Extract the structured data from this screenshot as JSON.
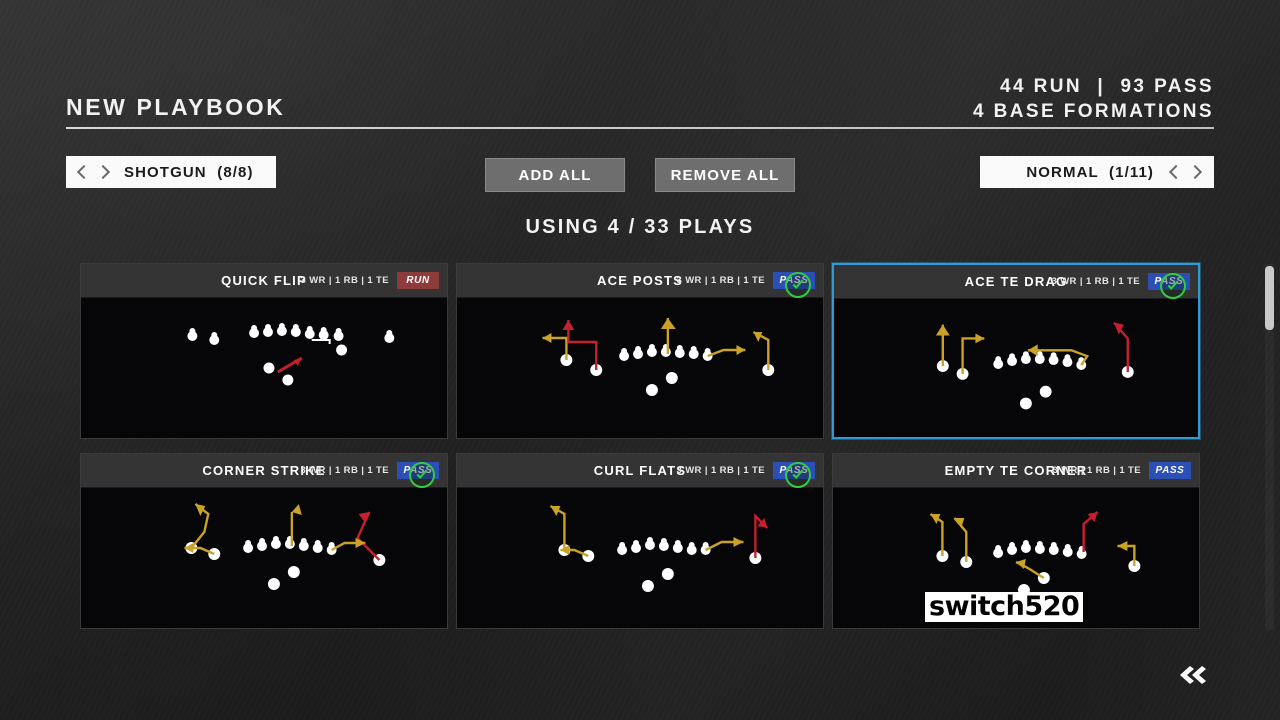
{
  "header": {
    "title": "NEW PLAYBOOK",
    "stats_line1": "44 RUN  |  93 PASS",
    "stats_line2": "4 BASE FORMATIONS"
  },
  "controls": {
    "formation_selector": {
      "label": "SHOTGUN  (8/8)",
      "prev_icon": "chevron-left-icon",
      "next_icon": "chevron-right-icon"
    },
    "situation_selector": {
      "label": "NORMAL  (1/11)",
      "prev_icon": "chevron-left-icon",
      "next_icon": "chevron-right-icon"
    },
    "add_all_label": "ADD ALL",
    "remove_all_label": "REMOVE ALL",
    "using_text": "USING 4 / 33 PLAYS"
  },
  "colors": {
    "accent_selected": "#2e9bd6",
    "pass_tag": "#2b4fb5",
    "run_tag": "#8d3b3b",
    "check_green": "#2fcc44",
    "route_gold": "#c9a227",
    "route_red": "#c42030",
    "background": "#262626",
    "card_bg": "#0a0a0a"
  },
  "plays": [
    {
      "name": "QUICK FLIP",
      "personnel": "3 WR | 1 RB | 1 TE",
      "tag": "RUN",
      "tag_type": "run",
      "added": false,
      "selected": false
    },
    {
      "name": "ACE POSTS",
      "personnel": "3 WR | 1 RB | 1 TE",
      "tag": "PASS",
      "tag_type": "pass",
      "added": true,
      "selected": false
    },
    {
      "name": "ACE TE DRAG",
      "personnel": "3 WR | 1 RB | 1 TE",
      "tag": "PASS",
      "tag_type": "pass",
      "added": true,
      "selected": true
    },
    {
      "name": "CORNER STRIKE",
      "personnel": "3 WR | 1 RB | 1 TE",
      "tag": "PASS",
      "tag_type": "pass",
      "added": true,
      "selected": false
    },
    {
      "name": "CURL FLATS",
      "personnel": "3 WR | 1 RB | 1 TE",
      "tag": "PASS",
      "tag_type": "pass",
      "added": true,
      "selected": false
    },
    {
      "name": "EMPTY TE CORNER",
      "personnel": "3 WR | 1 RB | 1 TE",
      "tag": "PASS",
      "tag_type": "pass",
      "added": false,
      "selected": false
    }
  ],
  "watermark": {
    "text": "switch520"
  },
  "footer": {
    "back_icon": "double-chevron-left-icon"
  },
  "scrollbar": {
    "position": "top"
  }
}
